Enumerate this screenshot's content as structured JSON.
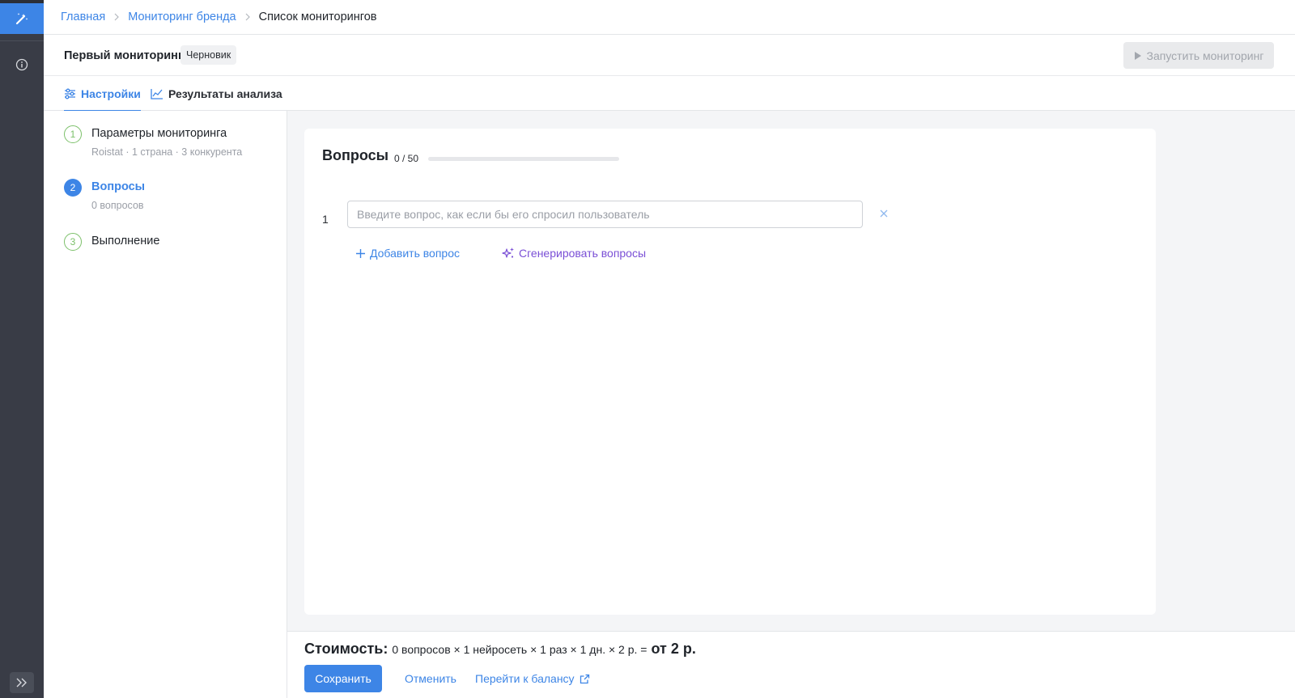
{
  "colors": {
    "accent": "#3d85e6",
    "rail": "#393c46",
    "done_step": "#7cc06a",
    "generate": "#7a4fd6"
  },
  "rail": {
    "logo_icon": "magic-wand-icon",
    "info_icon": "info-icon",
    "expand_icon": "double-chevron-right-icon"
  },
  "breadcrumb": {
    "items": [
      {
        "label": "Главная"
      },
      {
        "label": "Мониторинг бренда"
      },
      {
        "label": "Список мониторингов"
      }
    ]
  },
  "header": {
    "title": "Первый мониторинг",
    "status_badge": "Черновик",
    "run_button": "Запустить мониторинг"
  },
  "tabs": [
    {
      "label": "Настройки",
      "icon": "sliders-icon",
      "active": true
    },
    {
      "label": "Результаты анализа",
      "icon": "line-chart-icon",
      "active": false
    }
  ],
  "steps": [
    {
      "number": "1",
      "title": "Параметры мониторинга",
      "subtitle": "Roistat · 1 страна · 3 конкурента",
      "state": "done"
    },
    {
      "number": "2",
      "title": "Вопросы",
      "subtitle": "0 вопросов",
      "state": "active"
    },
    {
      "number": "3",
      "title": "Выполнение",
      "subtitle": "",
      "state": "pending"
    }
  ],
  "questions": {
    "title": "Вопросы",
    "counter": "0 / 50",
    "progress": 0,
    "rows": [
      {
        "number": "1",
        "value": "",
        "placeholder": "Введите вопрос, как если бы его спросил пользователь"
      }
    ],
    "add_button": "Добавить вопрос",
    "generate_button": "Сгенерировать вопросы"
  },
  "footer": {
    "cost_label": "Стоимость:",
    "cost_formula": "0 вопросов × 1 нейросеть × 1 раз × 1 дн. × 2 р. =",
    "cost_total": "от 2 р.",
    "save_button": "Сохранить",
    "cancel_link": "Отменить",
    "balance_link": "Перейти к балансу"
  }
}
